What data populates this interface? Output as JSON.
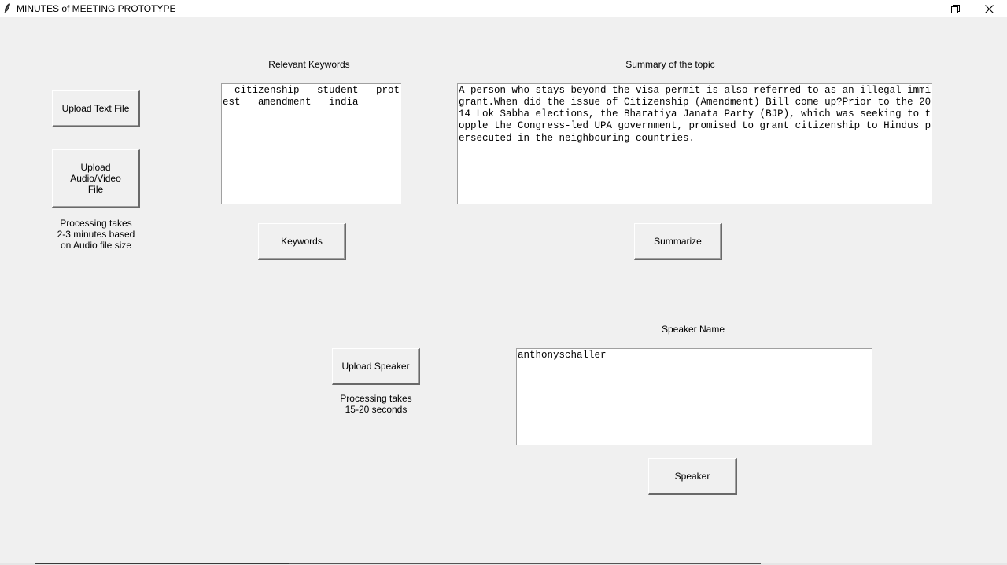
{
  "window": {
    "title": "MINUTES of MEETING PROTOTYPE",
    "controls": [
      "minimize",
      "restore",
      "close"
    ]
  },
  "left_panel": {
    "upload_text_label": "Upload Text File",
    "upload_audio_label_line1": "Upload Audio/Video",
    "upload_audio_label_line2": "File",
    "processing_note_line1": "Processing takes",
    "processing_note_line2": "2-3 minutes based",
    "processing_note_line3": "on Audio file size"
  },
  "keywords": {
    "heading": "Relevant Keywords",
    "text": "  citizenship   student   protest   amendment   india",
    "button_label": "Keywords"
  },
  "summary": {
    "heading": "Summary of the topic",
    "text": "A person who stays beyond the visa permit is also referred to as an illegal immigrant.When did the issue of Citizenship (Amendment) Bill come up?Prior to the 2014 Lok Sabha elections, the Bharatiya Janata Party (BJP), which was seeking to topple the Congress-led UPA government, promised to grant citizenship to Hindus persecuted in the neighbouring countries.",
    "button_label": "Summarize"
  },
  "speaker": {
    "upload_label": "Upload Speaker",
    "processing_note_line1": "Processing takes",
    "processing_note_line2": "15-20 seconds",
    "heading": "Speaker Name",
    "name_value": "anthonyschaller",
    "button_label": "Speaker"
  }
}
